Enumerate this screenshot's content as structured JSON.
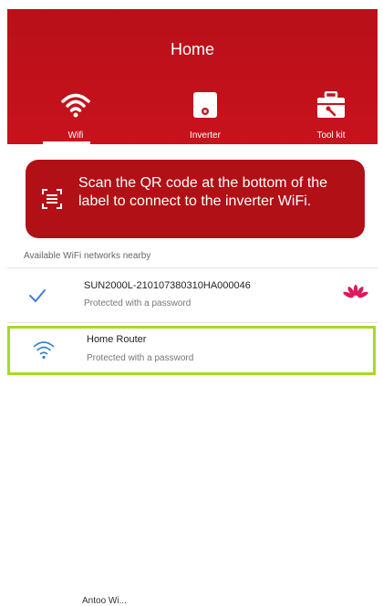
{
  "header": {
    "title": "Home",
    "tabs": [
      {
        "label": "Wifi",
        "icon": "wifi-icon"
      },
      {
        "label": "Inverter",
        "icon": "inverter-icon"
      },
      {
        "label": "Tool kit",
        "icon": "toolbox-icon"
      }
    ],
    "color": "#c8121c"
  },
  "banner": {
    "text": "Scan the QR code at the bottom of the label to connect to the inverter WiFi.",
    "icon": "qr-scan-icon"
  },
  "networks": {
    "section_label": "Available WiFi networks nearby",
    "items": [
      {
        "name": "SUN2000L-210107380310HA000046",
        "status": "Protected with a password",
        "connected": true,
        "brand_icon": "huawei-logo"
      },
      {
        "name": "Home Router",
        "status": "Protected with a password",
        "connected": false,
        "highlighted": true
      }
    ]
  },
  "footer": {
    "text": "Antoo Wi..."
  },
  "colors": {
    "brand": "#c8121c",
    "highlight": "#a7d928",
    "check": "#3d7fd8"
  }
}
